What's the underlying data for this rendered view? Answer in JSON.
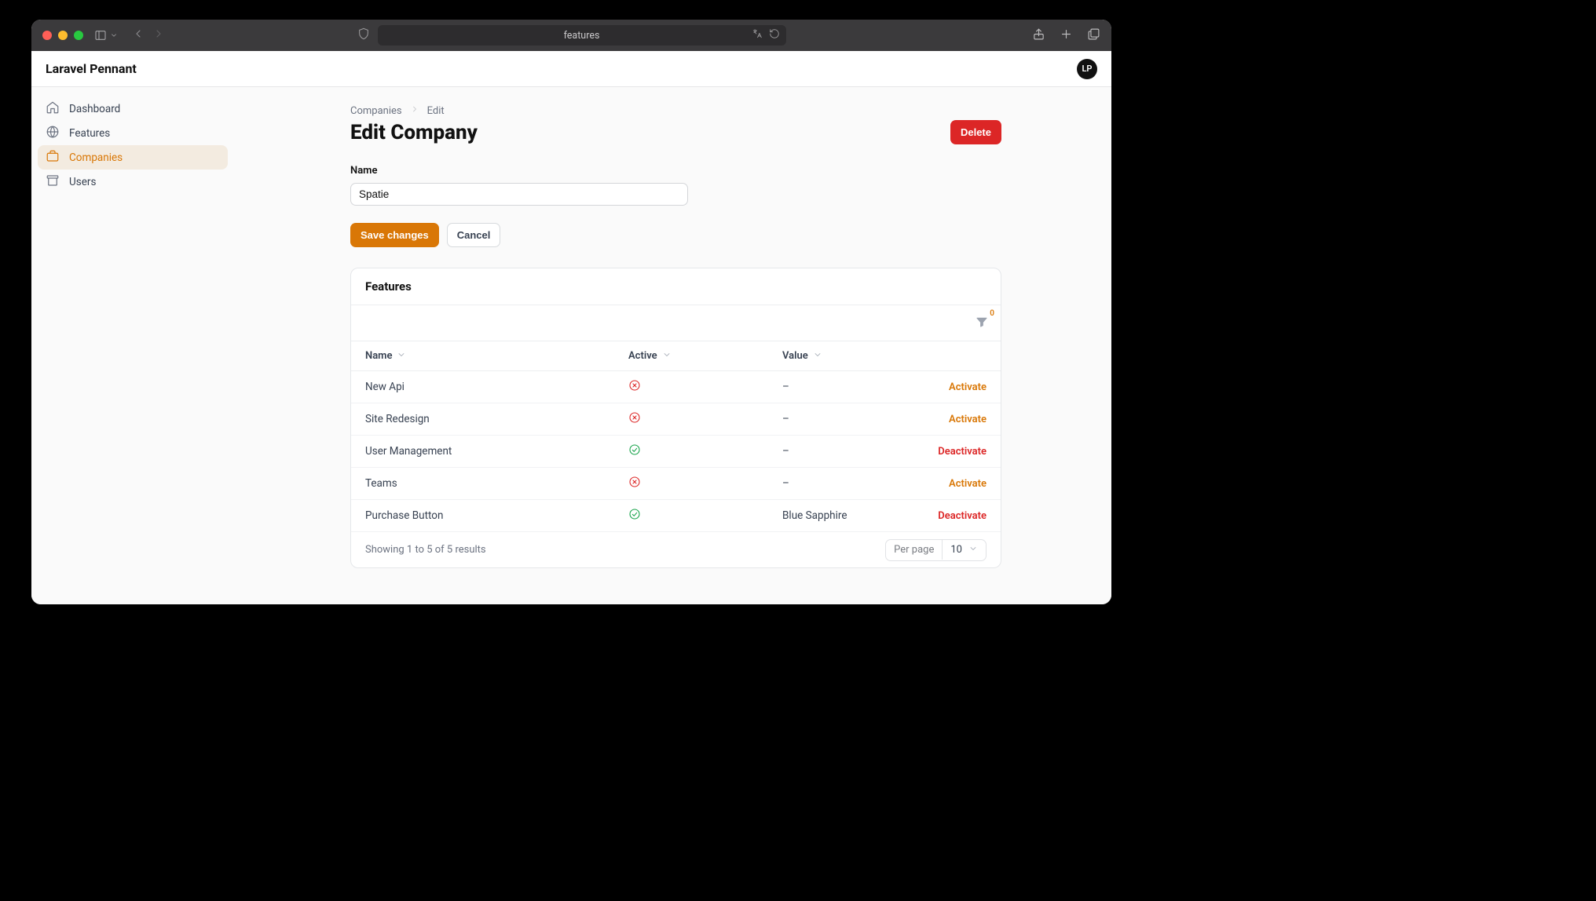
{
  "browser": {
    "address": "features"
  },
  "header": {
    "brand": "Laravel Pennant",
    "avatar_initials": "LP"
  },
  "sidebar": {
    "items": [
      {
        "label": "Dashboard"
      },
      {
        "label": "Features"
      },
      {
        "label": "Companies"
      },
      {
        "label": "Users"
      }
    ]
  },
  "breadcrumbs": {
    "parent": "Companies",
    "current": "Edit"
  },
  "page": {
    "title": "Edit Company",
    "delete_label": "Delete"
  },
  "form": {
    "name_label": "Name",
    "name_value": "Spatie",
    "save_label": "Save changes",
    "cancel_label": "Cancel"
  },
  "panel": {
    "title": "Features",
    "filter_badge": "0",
    "columns": {
      "name": "Name",
      "active": "Active",
      "value": "Value"
    },
    "rows": [
      {
        "name": "New Api",
        "active": false,
        "value": "–",
        "action": "Activate"
      },
      {
        "name": "Site Redesign",
        "active": false,
        "value": "–",
        "action": "Activate"
      },
      {
        "name": "User Management",
        "active": true,
        "value": "–",
        "action": "Deactivate"
      },
      {
        "name": "Teams",
        "active": false,
        "value": "–",
        "action": "Activate"
      },
      {
        "name": "Purchase Button",
        "active": true,
        "value": "Blue Sapphire",
        "action": "Deactivate"
      }
    ],
    "footer": {
      "summary": "Showing 1 to 5 of 5 results",
      "per_page_label": "Per page",
      "per_page_value": "10"
    }
  }
}
